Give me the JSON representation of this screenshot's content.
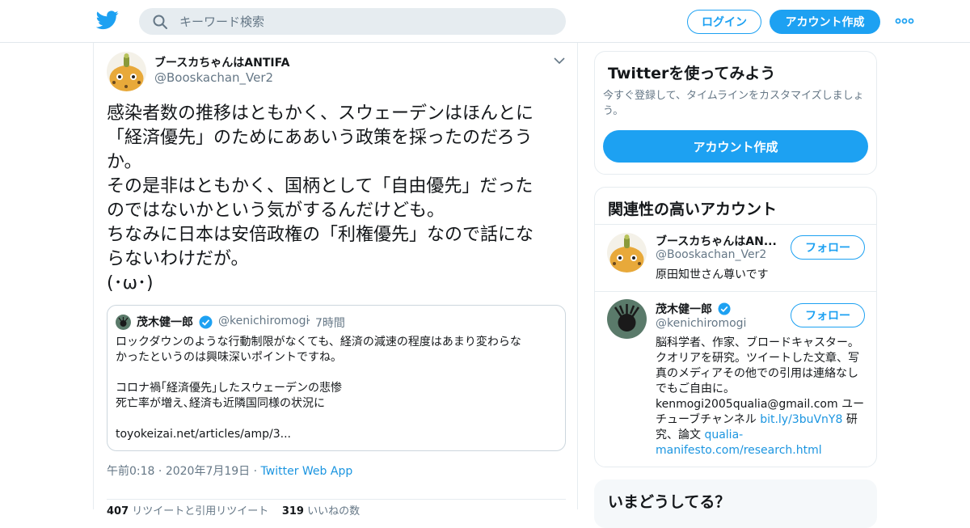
{
  "topbar": {
    "search_placeholder": "キーワード検索",
    "login_label": "ログイン",
    "signup_label": "アカウント作成"
  },
  "tweet": {
    "author_name": "ブースカちゃんはANTIFA",
    "author_handle": "@Booskachan_Ver2",
    "text": "感染者数の推移はともかく、スウェーデンはほんとに\n「経済優先」のためにああいう政策を採ったのだろう\nか。\nその是非はともかく、国柄として「自由優先」だった\nのではないかという気がするんだけども。\nちなみに日本は安倍政権の「利権優先」なので話にな\nらないわけだが。\n(･ω･)",
    "quoted": {
      "author_name": "茂木健一郎",
      "author_handle": "@kenichiromogi",
      "dot": "·",
      "time": "7時間",
      "text": "ロックダウンのような行動制限がなくても、経済の減速の程度はあまり変わらな\nかったというのは興味深いポイントですね。\n\nコロナ禍｢経済優先｣したスウェーデンの悲惨\n死亡率が増え､経済も近隣国同様の状況に\n\ntoyokeizai.net/articles/amp/3..."
    },
    "time": "午前0:18",
    "date": "2020年7月19日",
    "source": "Twitter Web App",
    "sep": "·",
    "retweet_count": "407",
    "retweet_label": "リツイートと引用リツイート",
    "like_count": "319",
    "like_label": "いいねの数"
  },
  "sidebar": {
    "try_twitter": {
      "title": "Twitterを使ってみよう",
      "desc": "今すぐ登録して、タイムラインをカスタマイズしましょう。",
      "button": "アカウント作成"
    },
    "related": {
      "title": "関連性の高いアカウント",
      "follow_label": "フォロー",
      "accounts": [
        {
          "name": "ブースカちゃんはAN...",
          "handle": "@Booskachan_Ver2",
          "bio": "原田知世さん尊いです"
        },
        {
          "name": "茂木健一郎",
          "handle": "@kenichiromogi",
          "bio": "脳科学者、作家、ブロードキャスター。クオリアを研究。ツイートした文章、写真のメディアその他での引用は連絡なしでもご自由に。kenmogi2005qualia@gmail.com ユーチューブチャンネル ",
          "link1": "bit.ly/3buVnY8",
          "bio2": " 研究、論文 ",
          "link2": "qualia-manifesto.com/research.html"
        }
      ]
    },
    "trends": {
      "title": "いまどうしてる？"
    }
  },
  "colors": {
    "accent": "#1da1f2",
    "link": "#1b95e0",
    "muted": "#657786"
  }
}
